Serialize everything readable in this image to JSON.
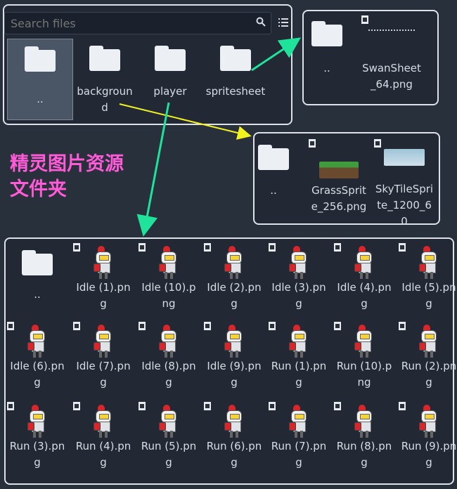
{
  "search": {
    "placeholder": "Search files"
  },
  "top_panel": {
    "items": [
      {
        "label": "..",
        "type": "folder",
        "selected": true
      },
      {
        "label": "background",
        "type": "folder"
      },
      {
        "label": "player",
        "type": "folder"
      },
      {
        "label": "spritesheet",
        "type": "folder"
      }
    ]
  },
  "spritesheet_panel": {
    "items": [
      {
        "label": "..",
        "type": "folder"
      },
      {
        "label": "SwanSheet_64.png",
        "type": "file"
      }
    ]
  },
  "background_panel": {
    "items": [
      {
        "label": "..",
        "type": "folder"
      },
      {
        "label": "GrassSprite_256.png",
        "type": "file"
      },
      {
        "label": "SkyTileSprite_1200_60",
        "type": "file"
      }
    ]
  },
  "annotation": {
    "line1": "精灵图片资源",
    "line2": "文件夹"
  },
  "player_panel": {
    "items": [
      {
        "label": "..",
        "type": "folder"
      },
      {
        "label": "Idle (1).png"
      },
      {
        "label": "Idle (10).png"
      },
      {
        "label": "Idle (2).png"
      },
      {
        "label": "Idle (3).png"
      },
      {
        "label": "Idle (4).png"
      },
      {
        "label": "Idle (5).png"
      },
      {
        "label": "Idle (6).png"
      },
      {
        "label": "Idle (7).png"
      },
      {
        "label": "Idle (8).png"
      },
      {
        "label": "Idle (9).png"
      },
      {
        "label": "Run (1).png"
      },
      {
        "label": "Run (10).png"
      },
      {
        "label": "Run (2).png"
      },
      {
        "label": "Run (3).png"
      },
      {
        "label": "Run (4).png"
      },
      {
        "label": "Run (5).png"
      },
      {
        "label": "Run (6).png"
      },
      {
        "label": "Run (7).png"
      },
      {
        "label": "Run (8).png"
      },
      {
        "label": "Run (9).png"
      }
    ]
  },
  "colors": {
    "arrow_green": "#1fe39a",
    "arrow_yellow": "#f2f21e",
    "annotation": "#ff5ad8"
  }
}
